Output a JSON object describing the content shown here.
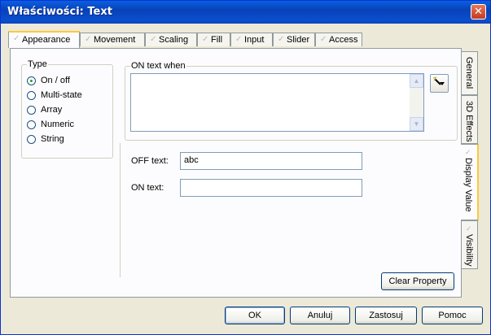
{
  "window": {
    "title": "Właściwości: Text",
    "close_icon": "close-icon",
    "title_color": "#0A4FCF"
  },
  "tabs": [
    {
      "label": "Appearance",
      "active": true
    },
    {
      "label": "Movement",
      "active": false
    },
    {
      "label": "Scaling",
      "active": false
    },
    {
      "label": "Fill",
      "active": false
    },
    {
      "label": "Input",
      "active": false
    },
    {
      "label": "Slider",
      "active": false
    },
    {
      "label": "Access",
      "active": false
    }
  ],
  "side_tabs": [
    {
      "label": "General",
      "active": false
    },
    {
      "label": "3D Effects",
      "active": false
    },
    {
      "label": "Display Value",
      "active": true
    },
    {
      "label": "Visibility",
      "active": false
    }
  ],
  "type_group": {
    "legend": "Type",
    "options": [
      {
        "label": "On / off",
        "selected": true
      },
      {
        "label": "Multi-state",
        "selected": false
      },
      {
        "label": "Array",
        "selected": false
      },
      {
        "label": "Numeric",
        "selected": false
      },
      {
        "label": "String",
        "selected": false
      }
    ]
  },
  "on_text_when": {
    "legend": "ON text when",
    "value": "",
    "button_icon": "expression-editor-icon"
  },
  "off_text": {
    "label": "OFF text:",
    "value": "abc"
  },
  "on_text": {
    "label": "ON text:",
    "value": ""
  },
  "clear_property": "Clear Property",
  "buttons": {
    "ok": "OK",
    "cancel": "Anuluj",
    "apply": "Zastosuj",
    "help": "Pomoc"
  }
}
